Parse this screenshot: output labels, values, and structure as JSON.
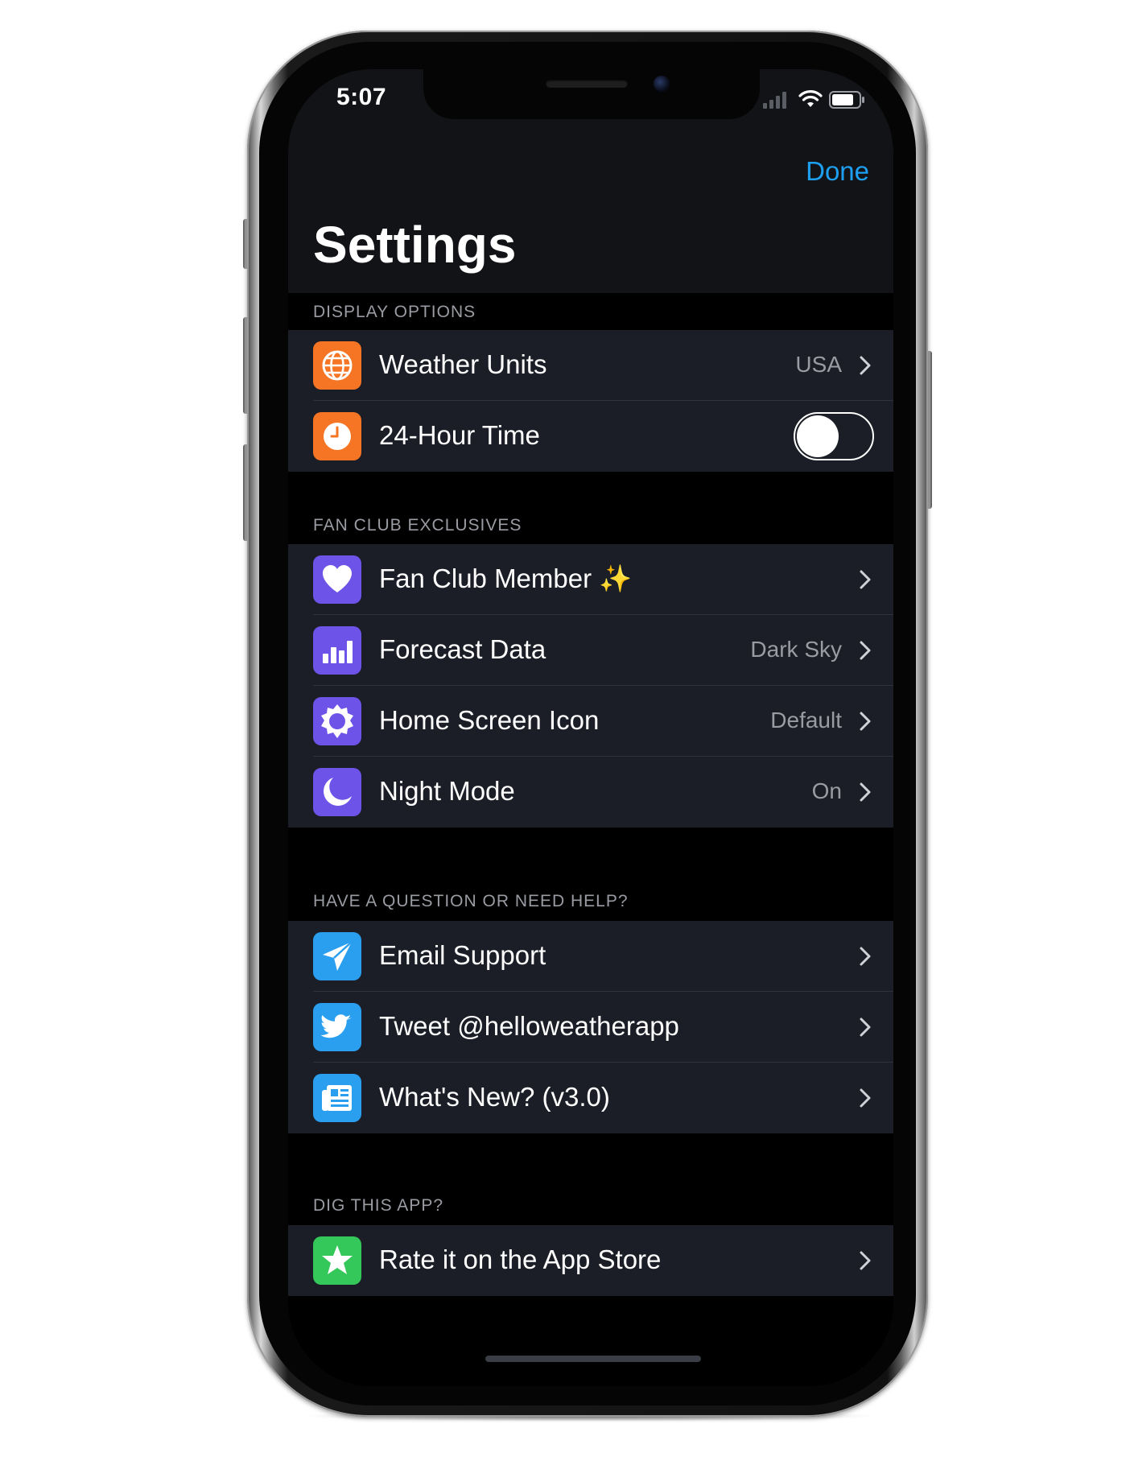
{
  "status_bar": {
    "time": "5:07"
  },
  "nav": {
    "done_label": "Done",
    "title": "Settings"
  },
  "sections": [
    {
      "header": "DISPLAY OPTIONS",
      "rows": [
        {
          "icon": "globe-icon",
          "label": "Weather Units",
          "value": "USA",
          "control": "chevron"
        },
        {
          "icon": "clock-icon",
          "label": "24-Hour Time",
          "value": "",
          "control": "toggle",
          "toggle_on": false
        }
      ]
    },
    {
      "header": "FAN CLUB EXCLUSIVES",
      "rows": [
        {
          "icon": "heart-icon",
          "label": "Fan Club Member ✨",
          "value": "",
          "control": "chevron"
        },
        {
          "icon": "bar-chart-icon",
          "label": "Forecast Data",
          "value": "Dark Sky",
          "control": "chevron"
        },
        {
          "icon": "sun-icon",
          "label": "Home Screen Icon",
          "value": "Default",
          "control": "chevron"
        },
        {
          "icon": "moon-icon",
          "label": "Night Mode",
          "value": "On",
          "control": "chevron"
        }
      ]
    },
    {
      "header": "HAVE A QUESTION OR NEED HELP?",
      "rows": [
        {
          "icon": "paper-plane-icon",
          "label": "Email Support",
          "value": "",
          "control": "chevron"
        },
        {
          "icon": "twitter-bird-icon",
          "label": "Tweet @helloweatherapp",
          "value": "",
          "control": "chevron"
        },
        {
          "icon": "newspaper-icon",
          "label": "What's New? (v3.0)",
          "value": "",
          "control": "chevron"
        }
      ]
    },
    {
      "header": "DIG THIS APP?",
      "rows": [
        {
          "icon": "star-icon",
          "label": "Rate it on the App Store",
          "value": "",
          "control": "chevron"
        }
      ]
    }
  ],
  "colors": {
    "accent": "#1ea0f2",
    "orange_icon": "#f57524",
    "purple_icon": "#6e53e8",
    "blue_icon": "#2a9ff0",
    "green_icon": "#34c759",
    "row_background": "#1b1e26",
    "screen_background": "#000000"
  }
}
